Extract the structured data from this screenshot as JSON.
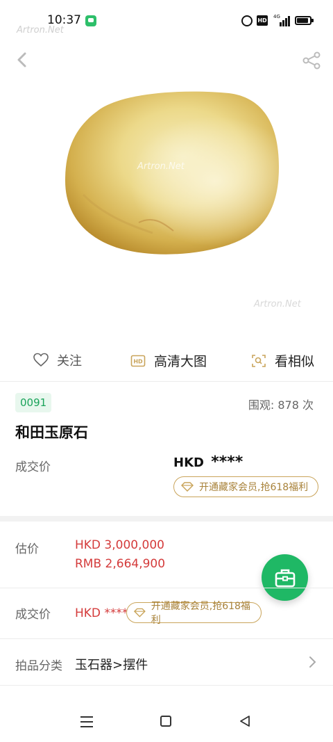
{
  "status_bar": {
    "time": "10:37",
    "network_label": "4G"
  },
  "watermarks": {
    "top": "Artron.Net",
    "center": "Artron.Net",
    "bottom": "Artron.Net"
  },
  "header": {
    "back_icon": "chevron-left-icon",
    "share_icon": "share-icon"
  },
  "actions": {
    "follow": {
      "label": "关注",
      "icon": "heart-icon"
    },
    "hd_image": {
      "label": "高清大图",
      "icon": "hd-icon"
    },
    "similar": {
      "label": "看相似",
      "icon": "scan-icon"
    }
  },
  "lot": {
    "number": "0091",
    "views": "围观: 878 次",
    "title": "和田玉原石"
  },
  "deal_top": {
    "label": "成交价",
    "currency": "HKD",
    "masked_value": "****",
    "vip_text": "开通藏家会员,抢618福利"
  },
  "estimate": {
    "label": "估价",
    "hkd": "HKD  3,000,000",
    "rmb": "RMB 2,664,900"
  },
  "deal_bottom": {
    "label": "成交价",
    "value": "HKD ****",
    "vip_text": "开通藏家会员,抢618福利"
  },
  "category": {
    "label": "拍品分类",
    "value": "玉石器>摆件"
  },
  "colors": {
    "accent_green": "#1fb865",
    "price_red": "#d43b3b",
    "vip_gold": "#c9a45a",
    "badge_bg": "#e8f7ee"
  }
}
